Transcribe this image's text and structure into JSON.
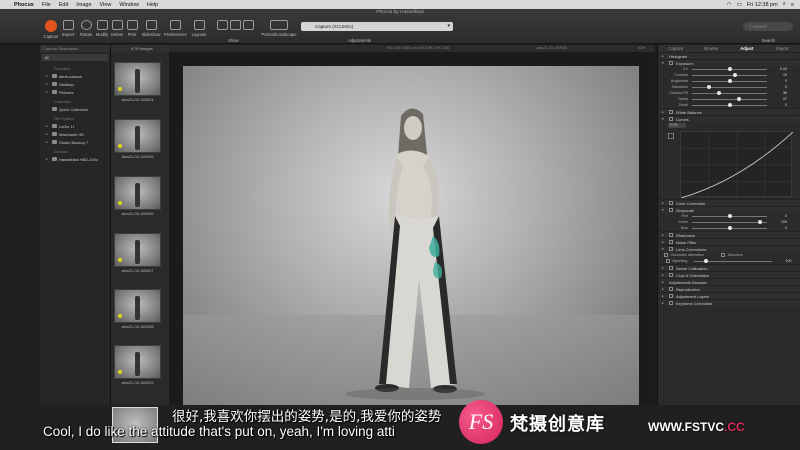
{
  "menubar": {
    "app": "Phocus",
    "items": [
      "File",
      "Edit",
      "Image",
      "View",
      "Window",
      "Help"
    ],
    "clock": "Fri 12:38 pm",
    "window_title": "Phocus by Hasselblad"
  },
  "toolbar": {
    "buttons": [
      "Capture",
      "Export",
      "Rotate",
      "Modify",
      "Delete",
      "Print",
      "Slideshow",
      "Preferences",
      "Layouts"
    ],
    "show_label": "Show",
    "portrait_label": "Portrait/Landscape",
    "session": "Capture (XCUKEn)",
    "adjustments_label": "Adjustments",
    "search_placeholder": "Search",
    "search_label": "Search"
  },
  "library": {
    "header": "Capture Destination",
    "selected": "Al",
    "favorites_label": "Favorites",
    "favorites": [
      "alexlucasson",
      "Desktop",
      "Pictures"
    ],
    "collection_label": "Collection",
    "quick_collection": "Quick Collection",
    "file_system_label": "File System",
    "file_system": [
      "LaCie 1t",
      "Macintosh HD",
      "Studio Backup 7"
    ],
    "devices_label": "Devices",
    "devices": [
      "Hasselblad H6D-100c"
    ]
  },
  "browser": {
    "count": "# 39 images",
    "thumbs": [
      "Ana21-02-160024",
      "Ana21-02-160025",
      "Ana21-02-160026",
      "Ana21-02-160027",
      "Ana21-02-160028",
      "Ana21-02-160029"
    ]
  },
  "viewer": {
    "meta": "ISO 100 1/800 sec f/8.0 5KC HC 150",
    "filename": "Ana21-02-160030",
    "zoom": "10%"
  },
  "panel": {
    "tabs": [
      "Capture",
      "Browse",
      "Adjust",
      "Export"
    ],
    "active_tab": "Adjust",
    "tools": {
      "histogram": "Histogram",
      "exposure": "Exposure",
      "white_balance": "White Balance",
      "curves": "Curves",
      "color_correction": "Color Correction",
      "grayscale": "Grayscale",
      "sharpness": "Sharpness",
      "noise_filter": "Noise Filter",
      "lens_corrections": "Lens Corrections",
      "scene_calibration": "Scene Calibration",
      "crop": "Crop & Orientation",
      "adjustments_browser": "Adjustments Browser",
      "reproduction": "Reproduction",
      "adjustment_layers": "Adjustment Layers",
      "keystone": "Keystone Correction"
    },
    "exposure_sliders": [
      {
        "label": "EV",
        "value": "0.00",
        "pos": 0.5
      },
      {
        "label": "Contrast",
        "value": "10",
        "pos": 0.56
      },
      {
        "label": "Brightness",
        "value": "0",
        "pos": 0.5
      },
      {
        "label": "Saturation",
        "value": "0",
        "pos": 0.22
      },
      {
        "label": "Shadow Fill",
        "value": "36",
        "pos": 0.35
      },
      {
        "label": "Clarity",
        "value": "27",
        "pos": 0.62
      },
      {
        "label": "Detail",
        "value": "0",
        "pos": 0.5
      }
    ],
    "curve_channel": "RGB",
    "grayscale_sliders": [
      {
        "label": "Red",
        "value": "0",
        "pos": 0.5
      },
      {
        "label": "Green",
        "value": "100",
        "pos": 0.9
      },
      {
        "label": "Blue",
        "value": "0",
        "pos": 0.5
      }
    ],
    "lens_options": [
      "Chromatic aberration",
      "Distortion"
    ],
    "vignetting": {
      "label": "Vignetting",
      "value": "100"
    }
  },
  "subtitles": {
    "chinese": "很好,我喜欢你摆出的姿势,是的,我爱你的姿势",
    "english": "Cool, I do like the attitude that's put on, yeah, I'm loving atti"
  },
  "watermark": {
    "logo": "FS",
    "brand": "梵摄创意库",
    "url_prefix": "WWW.",
    "url_domain": "FSTVC",
    "url_suffix": ".CC"
  }
}
